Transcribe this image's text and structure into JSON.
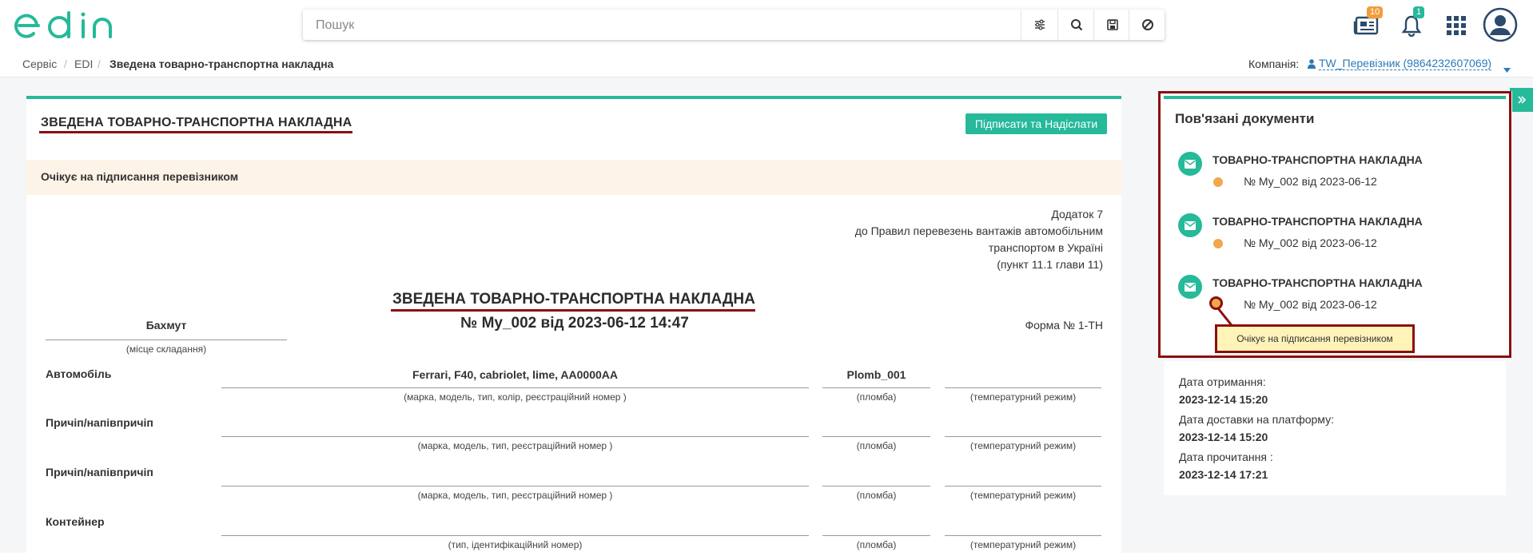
{
  "header": {
    "logo_text": "edin",
    "search": {
      "placeholder": "Пошук",
      "value": ""
    },
    "search_buttons": [
      "filter-icon",
      "search-icon",
      "save-icon",
      "clear-icon"
    ],
    "news_badge": "10",
    "notifications_badge": "1",
    "icons": [
      "news-icon",
      "bell-icon",
      "apps-grid-icon",
      "user-avatar-icon"
    ]
  },
  "breadcrumb": {
    "items": [
      "Сервіс",
      "EDI",
      "Зведена товарно-транспортна накладна"
    ],
    "company_label": "Компанія:",
    "company_value": "TW_Перевізник (9864232607069)"
  },
  "document": {
    "title": "ЗВЕДЕНА ТОВАРНО-ТРАНСПОРТНА НАКЛАДНА",
    "sign_button": "Підписати та Надіслати",
    "status_banner": "Очікує на підписання перевізником",
    "appendix": [
      "Додаток 7",
      "до Правил перевезень вантажів автомобільним",
      "транспортом в Україні",
      "(пункт 11.1 глави 11)"
    ],
    "form_title": "ЗВЕДЕНА ТОВАРНО-ТРАНСПОРТНА НАКЛАДНА",
    "form_number": "№ My_002 від 2023-06-12 14:47",
    "form_code": "Форма № 1-ТН",
    "place": "Бахмут",
    "place_hint": "(місце складання)",
    "rows": [
      {
        "label": "Автомобіль",
        "value": "Ferrari, F40, cabriolet, lime, AA0000AA",
        "seal": "Plomb_001",
        "hint": "(марка, модель, тип, колір, реєстраційний номер )",
        "seal_hint": "(пломба)",
        "temp_hint": "(температурний режим)"
      },
      {
        "label": "Причіп/напівпричіп",
        "value": "",
        "seal": "",
        "hint": "(марка, модель, тип, реєстраційний номер )",
        "seal_hint": "(пломба)",
        "temp_hint": "(температурний режим)"
      },
      {
        "label": "Причіп/напівпричіп",
        "value": "",
        "seal": "",
        "hint": "(марка, модель, тип, реєстраційний номер )",
        "seal_hint": "(пломба)",
        "temp_hint": "(температурний режим)"
      },
      {
        "label": "Контейнер",
        "value": "",
        "seal": "",
        "hint": "(тип, ідентифікаційний номер)",
        "seal_hint": "(пломба)",
        "temp_hint": "(температурний режим)"
      }
    ]
  },
  "related": {
    "title": "Пов'язані документи",
    "items": [
      {
        "title": "ТОВАРНО-ТРАНСПОРТНА НАКЛАДНА",
        "number": "№ My_002 від 2023-06-12"
      },
      {
        "title": "ТОВАРНО-ТРАНСПОРТНА НАКЛАДНА",
        "number": "№ My_002 від 2023-06-12"
      },
      {
        "title": "ТОВАРНО-ТРАНСПОРТНА НАКЛАДНА",
        "number": "№ My_002 від 2023-06-12"
      }
    ],
    "tooltip": "Очікує на підписання перевізником"
  },
  "dates": {
    "received_label": "Дата отримання:",
    "received_value": "2023-12-14 15:20",
    "delivered_label": "Дата доставки на платформу:",
    "delivered_value": "2023-12-14 15:20",
    "read_label": "Дата прочитання :",
    "read_value": "2023-12-14 17:21"
  },
  "colors": {
    "accent": "#26b99a",
    "highlight": "#8b0e0e",
    "status_dot": "#f0a84a",
    "banner_bg": "#fdf3e7",
    "tooltip_bg": "#fff3b8"
  }
}
